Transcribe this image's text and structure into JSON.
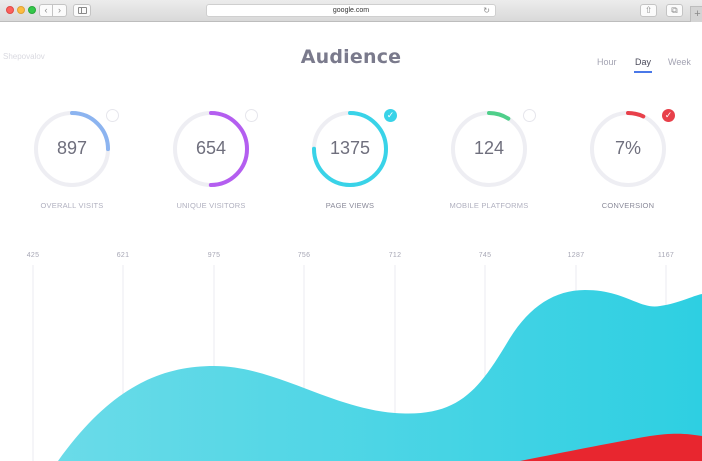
{
  "browser": {
    "url": "google.com",
    "icons": {
      "back": "chevron-left-icon",
      "forward": "chevron-right-icon",
      "sidebar": "sidebar-icon",
      "reload": "reload-icon",
      "share": "share-icon",
      "tabs": "tabs-icon",
      "new_tab": "plus-icon"
    }
  },
  "page": {
    "author": "Shepovalov",
    "title": "Audience"
  },
  "tabs": [
    {
      "label": "Hour",
      "active": false
    },
    {
      "label": "Day",
      "active": true
    },
    {
      "label": "Week",
      "active": false
    }
  ],
  "stats": [
    {
      "value": "897",
      "label": "OVERALL VISITS",
      "progress": 0.25,
      "color": "#8cb4f0",
      "checked": false
    },
    {
      "value": "654",
      "label": "UNIQUE VISITORS",
      "progress": 0.5,
      "color": "#b45ef0",
      "checked": false
    },
    {
      "value": "1375",
      "label": "PAGE VIEWS",
      "progress": 0.75,
      "color": "#39d3e8",
      "checked": true
    },
    {
      "value": "124",
      "label": "MOBILE PLATFORMS",
      "progress": 0.09,
      "color": "#4fcf8a",
      "checked": false
    },
    {
      "value": "7%",
      "label": "CONVERSION",
      "progress": 0.07,
      "color": "#e8404a",
      "checked": true
    }
  ],
  "chart_data": {
    "type": "area",
    "x_labels": [
      "425",
      "621",
      "975",
      "756",
      "712",
      "745",
      "1287",
      "1167"
    ],
    "series": [
      {
        "values": [
          425,
          621,
          975,
          756,
          712,
          745,
          1287,
          1167
        ],
        "color": "#2ecfe2"
      }
    ],
    "secondary_color": "#e8262f",
    "grid": true
  }
}
